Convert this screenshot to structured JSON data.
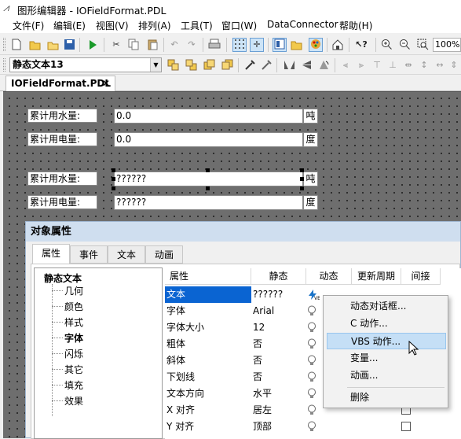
{
  "window": {
    "title": "图形编辑器 - IOFieldFormat.PDL"
  },
  "menubar": [
    "文件(F)",
    "编辑(E)",
    "视图(V)",
    "排列(A)",
    "工具(T)",
    "窗口(W)",
    "DataConnector",
    "帮助(H)"
  ],
  "toolbar": {
    "zoom": "100%",
    "style_combo": "静态文本13"
  },
  "doc_tab": {
    "label": "IOFieldFormat.PDL",
    "close": "✕"
  },
  "canvas": {
    "rows": [
      {
        "label": "累计用水量:",
        "value": "0.0",
        "unit": "吨"
      },
      {
        "label": "累计用电量:",
        "value": "0.0",
        "unit": "度"
      },
      {
        "label": "累计用水量:",
        "value": "??????",
        "unit": "吨"
      },
      {
        "label": "累计用电量:",
        "value": "??????",
        "unit": "度"
      }
    ]
  },
  "props": {
    "title": "对象属性",
    "tabs": [
      "属性",
      "事件",
      "文本",
      "动画"
    ],
    "tree": {
      "root": "静态文本",
      "items": [
        {
          "label": "几何",
          "bold": false
        },
        {
          "label": "颜色",
          "bold": false
        },
        {
          "label": "样式",
          "bold": false
        },
        {
          "label": "字体",
          "bold": true
        },
        {
          "label": "闪烁",
          "bold": false
        },
        {
          "label": "其它",
          "bold": false
        },
        {
          "label": "填充",
          "bold": false
        },
        {
          "label": "效果",
          "bold": false
        }
      ]
    },
    "grid": {
      "headers": [
        "属性",
        "静态",
        "动态",
        "更新周期",
        "间接"
      ],
      "rows": [
        {
          "name": "文本",
          "value": "??????",
          "selected": true
        },
        {
          "name": "字体",
          "value": "Arial"
        },
        {
          "name": "字体大小",
          "value": "12"
        },
        {
          "name": "粗体",
          "value": "否"
        },
        {
          "name": "斜体",
          "value": "否"
        },
        {
          "name": "下划线",
          "value": "否"
        },
        {
          "name": "文本方向",
          "value": "水平"
        },
        {
          "name": "X 对齐",
          "value": "居左"
        },
        {
          "name": "Y 对齐",
          "value": "顶部"
        }
      ]
    }
  },
  "context_menu": {
    "items": [
      "动态对话框...",
      "C 动作...",
      "VBS 动作...",
      "变量...",
      "动画..."
    ],
    "delete": "删除",
    "highlighted": "VBS 动作..."
  },
  "colors": {
    "selection": "#0a64d2",
    "menu_highlight": "#c5dff6",
    "dialog_title": "#cfdeef",
    "canvas": "#6e6e6e"
  }
}
